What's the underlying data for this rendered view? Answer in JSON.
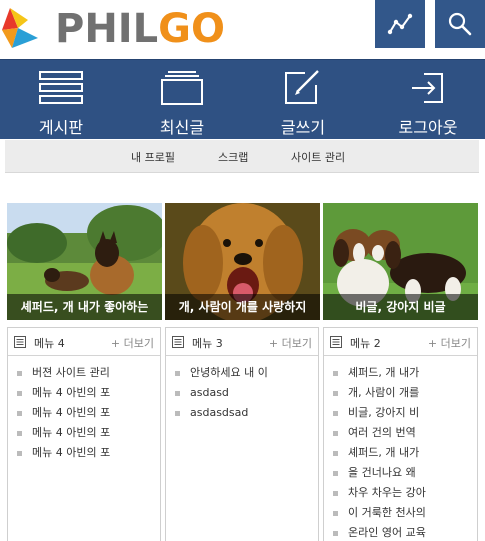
{
  "header": {
    "logo_text_1": "PHIL",
    "logo_text_2": "GO",
    "buttons": [
      {
        "icon": "trend-graph-icon"
      },
      {
        "icon": "search-icon"
      }
    ]
  },
  "nav": {
    "items": [
      {
        "label": "게시판",
        "icon": "list-icon"
      },
      {
        "label": "최신글",
        "icon": "stack-icon"
      },
      {
        "label": "글쓰기",
        "icon": "pencil-icon"
      },
      {
        "label": "로그아웃",
        "icon": "logout-icon"
      }
    ]
  },
  "submenu": {
    "items": [
      "내 프로필",
      "스크랩",
      "사이트 관리"
    ]
  },
  "photos": [
    {
      "caption": "셰퍼드, 개 내가 좋아하는"
    },
    {
      "caption": "개, 사람이 개를 사랑하지"
    },
    {
      "caption": "비글, 강아지 비글"
    }
  ],
  "panels": [
    {
      "title": "메뉴 4",
      "more": "+ 더보기",
      "items": [
        "버젼 사이트 관리",
        "메뉴 4 아빈의 포",
        "메뉴 4 아빈의 포",
        "메뉴 4 아빈의 포",
        "메뉴 4 아빈의 포"
      ]
    },
    {
      "title": "메뉴 3",
      "more": "+ 더보기",
      "items": [
        "안녕하세요 내 이",
        "asdasd",
        "asdasdsad"
      ]
    },
    {
      "title": "메뉴 2",
      "more": "+ 더보기",
      "items": [
        "셰퍼드, 개 내가",
        "개, 사람이 개를",
        "비글, 강아지 비",
        "여러 건의 번역",
        "셰퍼드, 개 내가",
        "을 건너나요 왜",
        "차우 차우는 강아",
        "이 거룩한 천사의",
        "온라인 영어 교육"
      ]
    }
  ],
  "colors": {
    "nav_bg": "#2f5183",
    "header_button_bg": "#32578a",
    "logo_gray": "#717171",
    "logo_orange": "#f0901a"
  }
}
